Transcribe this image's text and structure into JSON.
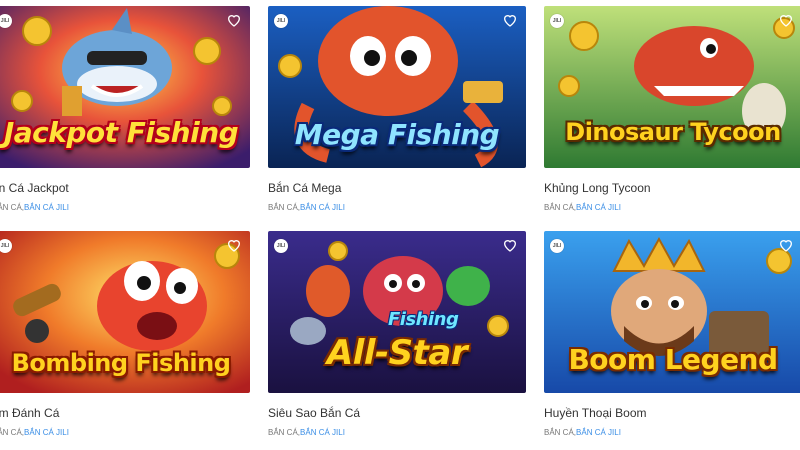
{
  "games": [
    {
      "title": "ắn Cá Jackpot",
      "logo": "Jackpot Fishing",
      "provider": "JILI",
      "tag_category": "BẮN CÁ,",
      "tag_provider": "BẮN CÁ JILI",
      "bg": "#1e6fd6"
    },
    {
      "title": "Bắn Cá Mega",
      "logo": "Mega Fishing",
      "provider": "JILI",
      "tag_category": "BẮN CÁ,",
      "tag_provider": "BẮN CÁ JILI",
      "bg": "#0d3e86"
    },
    {
      "title": "Khủng Long Tycoon",
      "logo": "Dinosaur Tycoon",
      "provider": "JILI",
      "tag_category": "BẮN CÁ,",
      "tag_provider": "BẮN CÁ JILI",
      "bg": "#2d8a3a"
    },
    {
      "title": "om Đánh Cá",
      "logo": "Bombing Fishing",
      "provider": "JILI",
      "tag_category": "BẮN CÁ,",
      "tag_provider": "BẮN CÁ JILI",
      "bg": "#d4322a"
    },
    {
      "title": "Siêu Sao Bắn Cá",
      "logo": "All-Star",
      "logo2": "Fishing",
      "provider": "JILI",
      "tag_category": "BẮN CÁ,",
      "tag_provider": "BẮN CÁ JILI",
      "bg": "#2a1f6e"
    },
    {
      "title": "Huyền Thoại Boom",
      "logo": "Boom Legend",
      "provider": "JILI",
      "tag_category": "BẮN CÁ,",
      "tag_provider": "BẮN CÁ JILI",
      "bg": "#1f6fc9"
    }
  ],
  "icons": {
    "provider_badge": "jili-badge-icon",
    "favorite": "heart-icon"
  }
}
